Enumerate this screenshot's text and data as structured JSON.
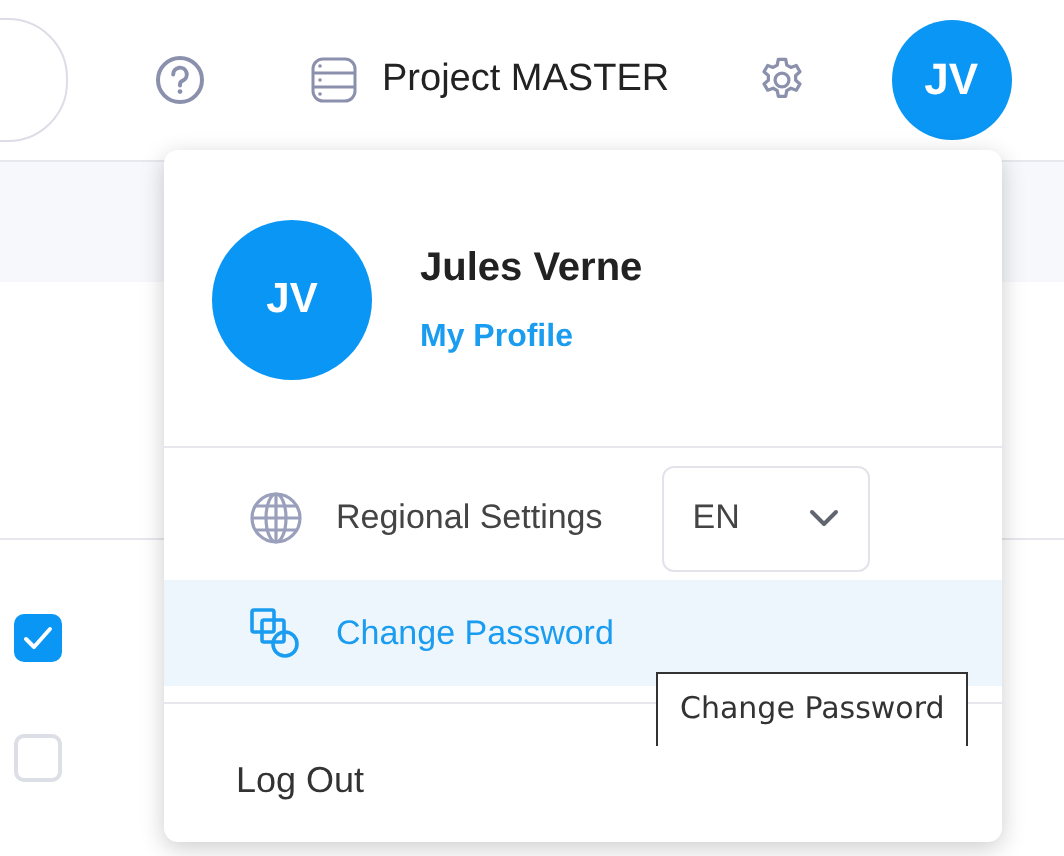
{
  "header": {
    "project": "Project MASTER",
    "avatar_initials": "JV"
  },
  "checkboxes": [
    {
      "checked": true
    },
    {
      "checked": false
    }
  ],
  "menu": {
    "avatar_initials": "JV",
    "name": "Jules Verne",
    "profile_link": "My Profile",
    "items": [
      {
        "kind": "regional",
        "label": "Regional Settings",
        "language": "EN",
        "selected": false
      },
      {
        "kind": "password",
        "label": "Change Password",
        "selected": true
      },
      {
        "kind": "logout",
        "label": "Log Out",
        "selected": false
      }
    ]
  },
  "tooltip": "Change Password"
}
